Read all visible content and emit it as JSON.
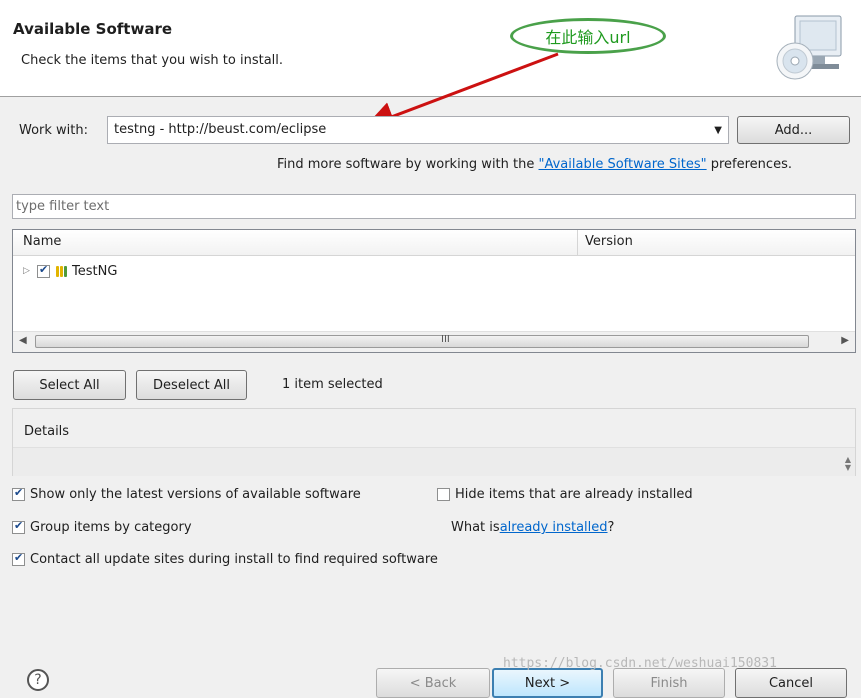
{
  "banner": {
    "title": "Available Software",
    "description": "Check the items that you wish to install.",
    "annotation": "在此输入url"
  },
  "work_with": {
    "label": "Work with:",
    "value": "testng - http://beust.com/eclipse",
    "add_label": "Add..."
  },
  "hint": {
    "prefix": "Find more software by working with the ",
    "link": "\"Available Software Sites\"",
    "suffix": " preferences."
  },
  "filter": {
    "placeholder": "type filter text"
  },
  "table": {
    "columns": [
      "Name",
      "Version"
    ],
    "rows": [
      {
        "name": "TestNG",
        "checked": true,
        "version": ""
      }
    ],
    "scroll_grip": "III"
  },
  "selection": {
    "select_all": "Select All",
    "deselect_all": "Deselect All",
    "count_text": "1 item selected"
  },
  "details": {
    "label": "Details"
  },
  "options": {
    "latest_only": {
      "label": "Show only the latest versions of available software",
      "checked": true
    },
    "hide_installed": {
      "label": "Hide items that are already installed",
      "checked": false
    },
    "group_by_category": {
      "label": "Group items by category",
      "checked": true
    },
    "what_is_prefix": "What is ",
    "what_is_link": "already installed",
    "what_is_suffix": "?",
    "contact_all": {
      "label": "Contact all update sites during install to find required software",
      "checked": true
    }
  },
  "footer": {
    "help": "?",
    "back": "< Back",
    "next": "Next >",
    "finish": "Finish",
    "cancel": "Cancel",
    "watermark": "https://blog.csdn.net/weshuai150831"
  },
  "colors": {
    "annotation_border": "#4aa14a",
    "arrow": "#cc1111",
    "link": "#0066cc"
  }
}
